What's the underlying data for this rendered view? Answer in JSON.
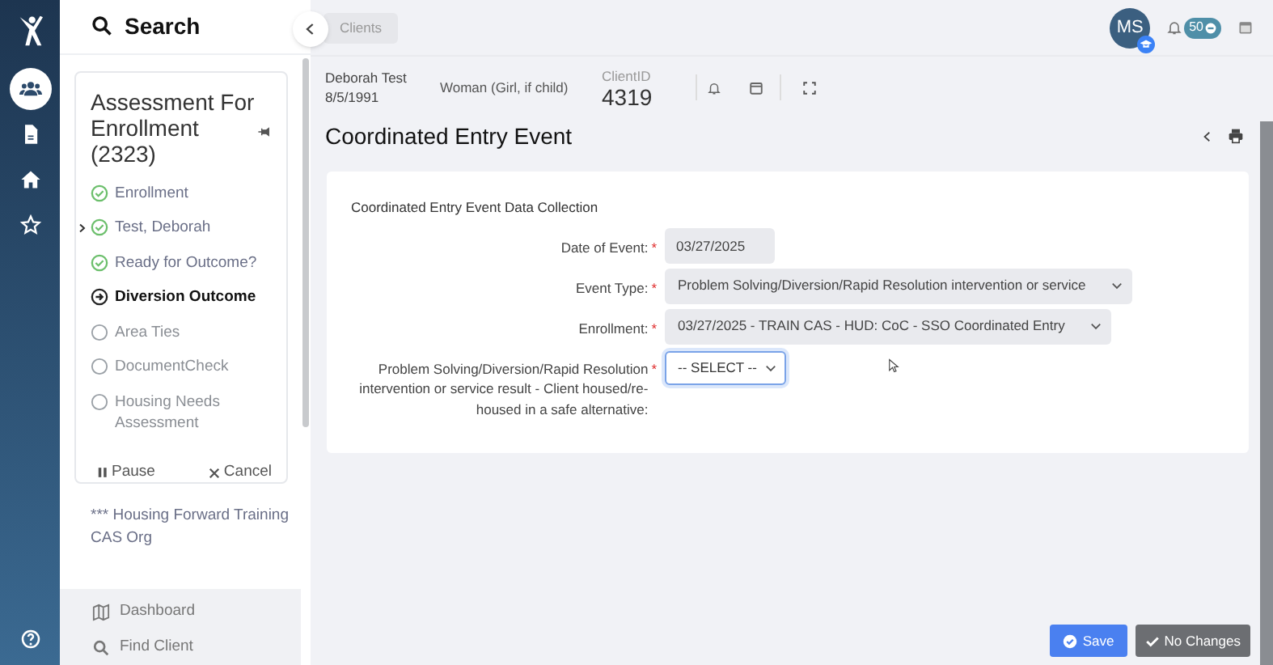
{
  "rail": {
    "items": [
      {
        "kind": "people",
        "selected": true
      },
      {
        "kind": "document",
        "selected": false
      },
      {
        "kind": "home",
        "selected": false
      },
      {
        "kind": "star",
        "selected": false
      }
    ]
  },
  "sidebar": {
    "search_label": "Search",
    "workflow": {
      "title": "Assessment For Enrollment (2323)",
      "steps": [
        {
          "label": "Enrollment",
          "kind": "done",
          "marked": false
        },
        {
          "label": "Test, Deborah",
          "kind": "done",
          "marked": true
        },
        {
          "label": "Ready for Outcome?",
          "kind": "done",
          "marked": false
        },
        {
          "label": "Diversion Outcome",
          "kind": "current",
          "marked": false
        },
        {
          "label": "Area Ties",
          "kind": "pending",
          "marked": false
        },
        {
          "label": "DocumentCheck",
          "kind": "pending",
          "marked": false
        },
        {
          "label": "Housing Needs Assessment",
          "kind": "pending",
          "marked": false
        }
      ],
      "pause": "Pause",
      "cancel": "Cancel"
    },
    "org": "*** Housing Forward Training CAS Org",
    "nav": [
      {
        "kind": "map",
        "label": "Dashboard"
      },
      {
        "kind": "search",
        "label": "Find Client"
      }
    ]
  },
  "topbar": {
    "breadcrumb": "Clients",
    "avatar": "MS",
    "notification_count": "50"
  },
  "client": {
    "name": "Deborah Test",
    "dob": "8/5/1991",
    "gender": "Woman (Girl, if child)",
    "id_label": "ClientID",
    "id": "4319"
  },
  "page_title": "Coordinated Entry Event",
  "form": {
    "section": "Coordinated Entry Event Data Collection",
    "fields": [
      {
        "kind": "date",
        "label": "Date of Event:",
        "required_mark": "*",
        "value": "03/27/2025"
      },
      {
        "kind": "select",
        "label": "Event Type:",
        "required_mark": "*",
        "value": "Problem Solving/Diversion/Rapid Resolution intervention or service",
        "focused": false
      },
      {
        "kind": "select",
        "label": "Enrollment:",
        "required_mark": "*",
        "value": "03/27/2025 - TRAIN CAS - HUD: CoC - SSO Coordinated Entry",
        "focused": false
      },
      {
        "kind": "select",
        "label": "Problem Solving/Diversion/Rapid Resolution intervention or service result - Client housed/re-housed in a safe alternative:",
        "required_mark": "*",
        "value": "-- SELECT --",
        "focused": true
      }
    ]
  },
  "buttons": [
    {
      "kind": "primary",
      "label": "Save"
    },
    {
      "kind": "secondary",
      "label": "No Changes"
    }
  ]
}
